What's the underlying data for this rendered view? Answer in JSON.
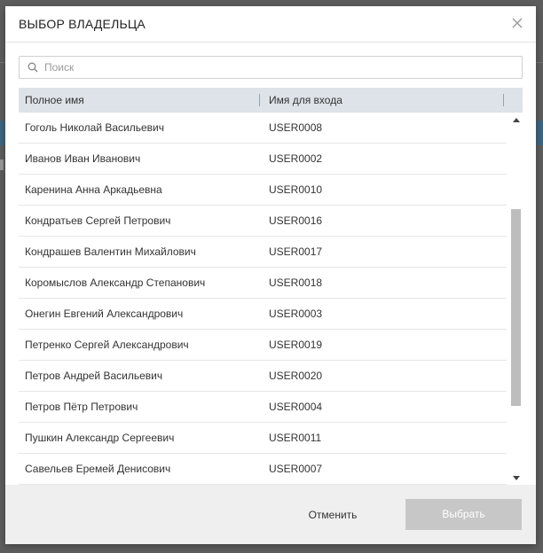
{
  "dialog": {
    "title": "ВЫБОР ВЛАДЕЛЬЦА",
    "search": {
      "placeholder": "Поиск",
      "value": ""
    },
    "table": {
      "columns": [
        "Полное имя",
        "Имя для входа"
      ],
      "rows": [
        [
          "Гоголь Николай Васильевич",
          "USER0008"
        ],
        [
          "Иванов Иван Иванович",
          "USER0002"
        ],
        [
          "Каренина Анна Аркадьевна",
          "USER0010"
        ],
        [
          "Кондратьев Сергей Петрович",
          "USER0016"
        ],
        [
          "Кондрашев Валентин Михайлович",
          "USER0017"
        ],
        [
          "Коромыслов Александр Степанович",
          "USER0018"
        ],
        [
          "Онегин Евгений Александрович",
          "USER0003"
        ],
        [
          "Петренко Сергей Александрович",
          "USER0019"
        ],
        [
          "Петров Андрей Васильевич",
          "USER0020"
        ],
        [
          "Петров Пётр Петрович",
          "USER0004"
        ],
        [
          "Пушкин Александр Сергеевич",
          "USER0011"
        ],
        [
          "Савельев Еремей Денисович",
          "USER0007"
        ]
      ]
    },
    "buttons": {
      "cancel": "Отменить",
      "select": "Выбрать"
    },
    "colors": {
      "header_bg": "#dde3e8",
      "select_disabled": "#c7c7c7",
      "footer_bg": "#efefef"
    }
  }
}
